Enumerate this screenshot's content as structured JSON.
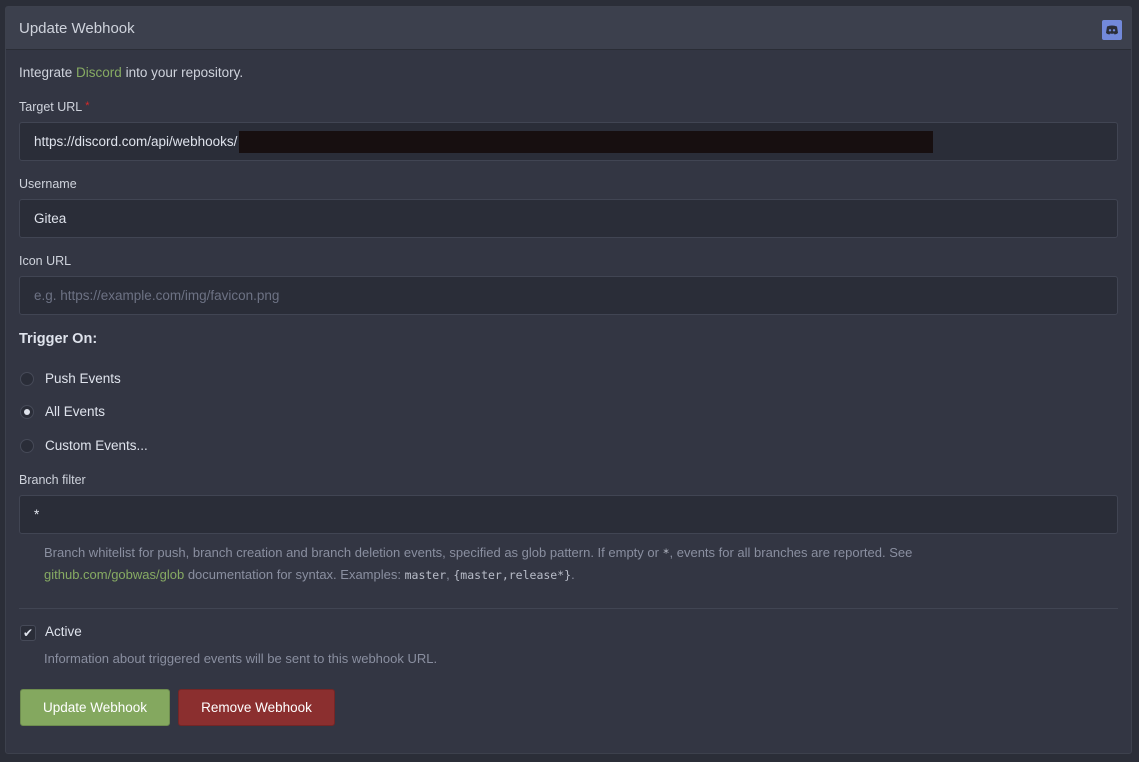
{
  "header": {
    "title": "Update Webhook",
    "icon": "discord-icon"
  },
  "intro": {
    "prefix": "Integrate ",
    "link": "Discord",
    "suffix": " into your repository."
  },
  "fields": {
    "target_url": {
      "label": "Target URL",
      "required_mark": "*",
      "value": "https://discord.com/api/webhooks/"
    },
    "username": {
      "label": "Username",
      "value": "Gitea"
    },
    "icon_url": {
      "label": "Icon URL",
      "placeholder": "e.g. https://example.com/img/favicon.png",
      "value": ""
    }
  },
  "trigger": {
    "title": "Trigger On:",
    "options": [
      {
        "label": "Push Events",
        "checked": false
      },
      {
        "label": "All Events",
        "checked": true
      },
      {
        "label": "Custom Events...",
        "checked": false
      }
    ]
  },
  "branch_filter": {
    "label": "Branch filter",
    "value": "*",
    "help_1": "Branch whitelist for push, branch creation and branch deletion events, specified as glob pattern. If empty or ",
    "help_code_1": "*",
    "help_2": ", events for all branches are reported. See",
    "help_link": "github.com/gobwas/glob",
    "help_3": " documentation for syntax. Examples: ",
    "help_code_2": "master",
    "help_4": ", ",
    "help_code_3": "{master,release*}",
    "help_5": "."
  },
  "active": {
    "label": "Active",
    "checked": true,
    "check_glyph": "✔",
    "help": "Information about triggered events will be sent to this webhook URL."
  },
  "buttons": {
    "update": "Update Webhook",
    "remove": "Remove Webhook"
  },
  "colors": {
    "accent_green": "#84a85f",
    "danger_red": "#8b2f2f",
    "link_green": "#87ab63",
    "discord_blurple": "#7289da"
  }
}
